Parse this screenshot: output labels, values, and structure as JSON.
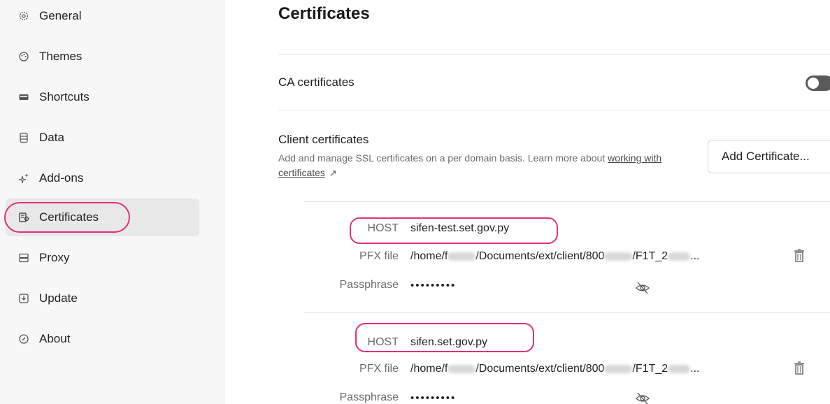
{
  "sidebar": {
    "items": [
      {
        "label": "General",
        "icon": "gear-icon"
      },
      {
        "label": "Themes",
        "icon": "palette-icon"
      },
      {
        "label": "Shortcuts",
        "icon": "keyboard-icon"
      },
      {
        "label": "Data",
        "icon": "database-icon"
      },
      {
        "label": "Add-ons",
        "icon": "sparkle-icon"
      },
      {
        "label": "Certificates",
        "icon": "certificate-icon",
        "active": true
      },
      {
        "label": "Proxy",
        "icon": "server-icon"
      },
      {
        "label": "Update",
        "icon": "download-icon"
      },
      {
        "label": "About",
        "icon": "info-icon"
      }
    ]
  },
  "main": {
    "title": "Certificates",
    "ca": {
      "label": "CA certificates",
      "enabled": false
    },
    "client": {
      "label": "Client certificates",
      "desc_prefix": "Add and manage SSL certificates on a per domain basis. Learn more about",
      "link": "working with certificates",
      "link_arrow": "↗",
      "add_button": "Add Certificate..."
    },
    "labels": {
      "host": "HOST",
      "pfx": "PFX file",
      "passphrase": "Passphrase"
    },
    "certs": [
      {
        "host": "sifen-test.set.gov.py",
        "pfx_prefix": "/home/f",
        "pfx_mid": "/Documents/ext/client/800",
        "pfx_mid2": "/F1T_2",
        "pfx_suffix": "...",
        "passphrase": "•••••••••"
      },
      {
        "host": "sifen.set.gov.py",
        "pfx_prefix": "/home/f",
        "pfx_mid": "/Documents/ext/client/800",
        "pfx_mid2": "/F1T_2",
        "pfx_suffix": "...",
        "passphrase": "•••••••••"
      }
    ]
  },
  "colors": {
    "highlight": "#e0307a",
    "sidebar_bg": "#f7f7f7",
    "active_bg": "#e8e8e8"
  }
}
